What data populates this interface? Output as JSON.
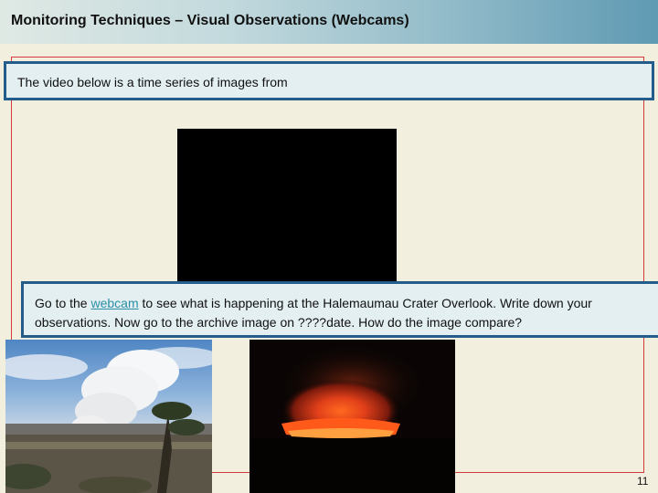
{
  "slide": {
    "title": "Monitoring Techniques – Visual Observations (Webcams)",
    "intro": "The video below is a time series of images from",
    "webcam_instruction": {
      "before_link": "Go to the ",
      "link_text": "webcam",
      "after_link": " to see what is happening at the Halemaumau Crater Overlook.  Write down your observations.  Now go to the archive image on ????date.  How do the image compare?"
    },
    "page_number": "11"
  },
  "images": {
    "left_photo_icon": "volcanic-plume-photo",
    "right_photo_icon": "lava-crater-glow-photo",
    "video_icon": "video-player"
  },
  "colors": {
    "title_gradient_end": "#5f9ab3",
    "box_border": "#245d8c",
    "frame_border": "#d43a3a",
    "link": "#2a8fa5"
  }
}
